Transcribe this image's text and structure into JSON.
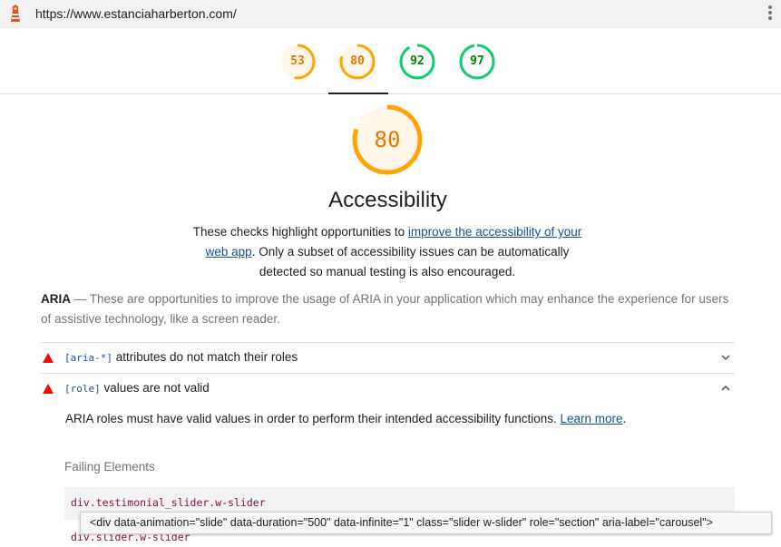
{
  "url_bar": {
    "url": "https://www.estanciaharberton.com/",
    "logo_icon": "lighthouse-icon",
    "menu_icon": "kebab-menu-icon"
  },
  "score_gauges": [
    {
      "label": "53",
      "value": 53,
      "color": "#ffa400",
      "fill": "#fff7ea",
      "text_color": "#e67700"
    },
    {
      "label": "80",
      "value": 80,
      "color": "#ffa400",
      "fill": "#fff7ea",
      "text_color": "#e67700",
      "active": true
    },
    {
      "label": "92",
      "value": 92,
      "color": "#0cce6b",
      "fill": "#ffffff",
      "text_color": "#008800"
    },
    {
      "label": "97",
      "value": 97,
      "color": "#0cce6b",
      "fill": "#ffffff",
      "text_color": "#008800"
    }
  ],
  "category": {
    "score": "80",
    "score_value": 80,
    "title": "Accessibility",
    "desc_before": "These checks highlight opportunities to ",
    "desc_link": "improve the accessibility of your web app",
    "desc_after": ". Only a subset of accessibility issues can be automatically detected so manual testing is also encouraged."
  },
  "group": {
    "title": "ARIA",
    "separator": " — ",
    "description": "These are opportunities to improve the usage of ARIA in your application which may enhance the experience for users of assistive technology, like a screen reader."
  },
  "audits": [
    {
      "code": "[aria-*]",
      "title": " attributes do not match their roles",
      "expanded": false,
      "chevron": "chevron-down-icon"
    },
    {
      "code": "[role]",
      "title": " values are not valid",
      "expanded": true,
      "chevron": "chevron-up-icon"
    }
  ],
  "audit_detail": {
    "description": "ARIA roles must have valid values in order to perform their intended accessibility functions. ",
    "learn_more": "Learn more",
    "end": ".",
    "failing_header": "Failing Elements",
    "nodes": [
      "div.testimonial_slider.w-slider",
      "div.slider.w-slider"
    ]
  },
  "tooltip": {
    "text": "<div data-animation=\"slide\" data-duration=\"500\" data-infinite=\"1\" class=\"slider w-slider\" role=\"section\" aria-label=\"carousel\">"
  },
  "colors": {
    "fail": "#eb0f00",
    "average": "#ffa400",
    "pass": "#0cce6b",
    "link": "#1a4f9c"
  }
}
